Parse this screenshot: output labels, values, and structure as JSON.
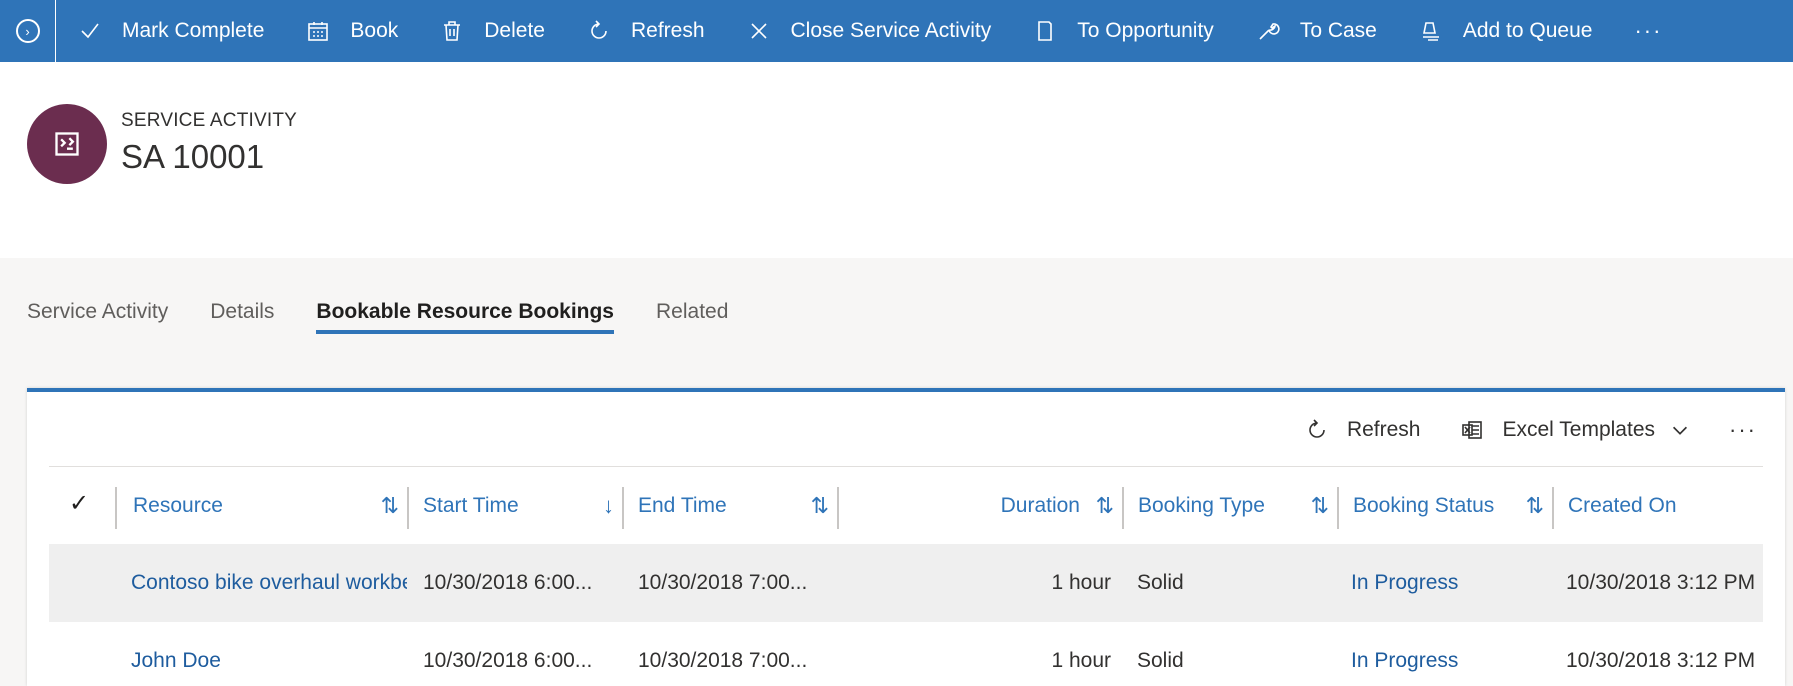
{
  "commandbar": {
    "items": [
      {
        "label": "Mark Complete",
        "icon": "checkmark-icon"
      },
      {
        "label": "Book",
        "icon": "calendar-icon"
      },
      {
        "label": "Delete",
        "icon": "trash-icon"
      },
      {
        "label": "Refresh",
        "icon": "refresh-icon"
      },
      {
        "label": "Close Service Activity",
        "icon": "close-icon"
      },
      {
        "label": "To Opportunity",
        "icon": "document-icon"
      },
      {
        "label": "To Case",
        "icon": "wrench-icon"
      },
      {
        "label": "Add to Queue",
        "icon": "queue-icon"
      }
    ],
    "more": "···"
  },
  "header": {
    "entity_type": "SERVICE ACTIVITY",
    "record_name": "SA 10001"
  },
  "tabs": [
    {
      "label": "Service Activity",
      "active": false
    },
    {
      "label": "Details",
      "active": false
    },
    {
      "label": "Bookable Resource Bookings",
      "active": true
    },
    {
      "label": "Related",
      "active": false
    }
  ],
  "grid_toolbar": {
    "refresh": "Refresh",
    "excel_templates": "Excel Templates",
    "more": "···"
  },
  "grid": {
    "select_all": "✓",
    "columns": [
      {
        "label": "Resource",
        "sort": "⇅"
      },
      {
        "label": "Start Time",
        "sort": "↓"
      },
      {
        "label": "End Time",
        "sort": "⇅"
      },
      {
        "label": "Duration",
        "sort": "⇅"
      },
      {
        "label": "Booking Type",
        "sort": "⇅"
      },
      {
        "label": "Booking Status",
        "sort": "⇅"
      },
      {
        "label": "Created On",
        "sort": ""
      }
    ],
    "rows": [
      {
        "resource": "Contoso bike overhaul workbe",
        "start": "10/30/2018 6:00...",
        "end": "10/30/2018 7:00...",
        "duration": "1 hour",
        "type": "Solid",
        "status": "In Progress",
        "created": "10/30/2018 3:12 PM"
      },
      {
        "resource": "John Doe",
        "start": "10/30/2018 6:00...",
        "end": "10/30/2018 7:00...",
        "duration": "1 hour",
        "type": "Solid",
        "status": "In Progress",
        "created": "10/30/2018 3:12 PM"
      }
    ]
  },
  "colors": {
    "command_bar": "#2f74b8",
    "entity_icon": "#6b2d4f",
    "link": "#1e5c9e"
  }
}
